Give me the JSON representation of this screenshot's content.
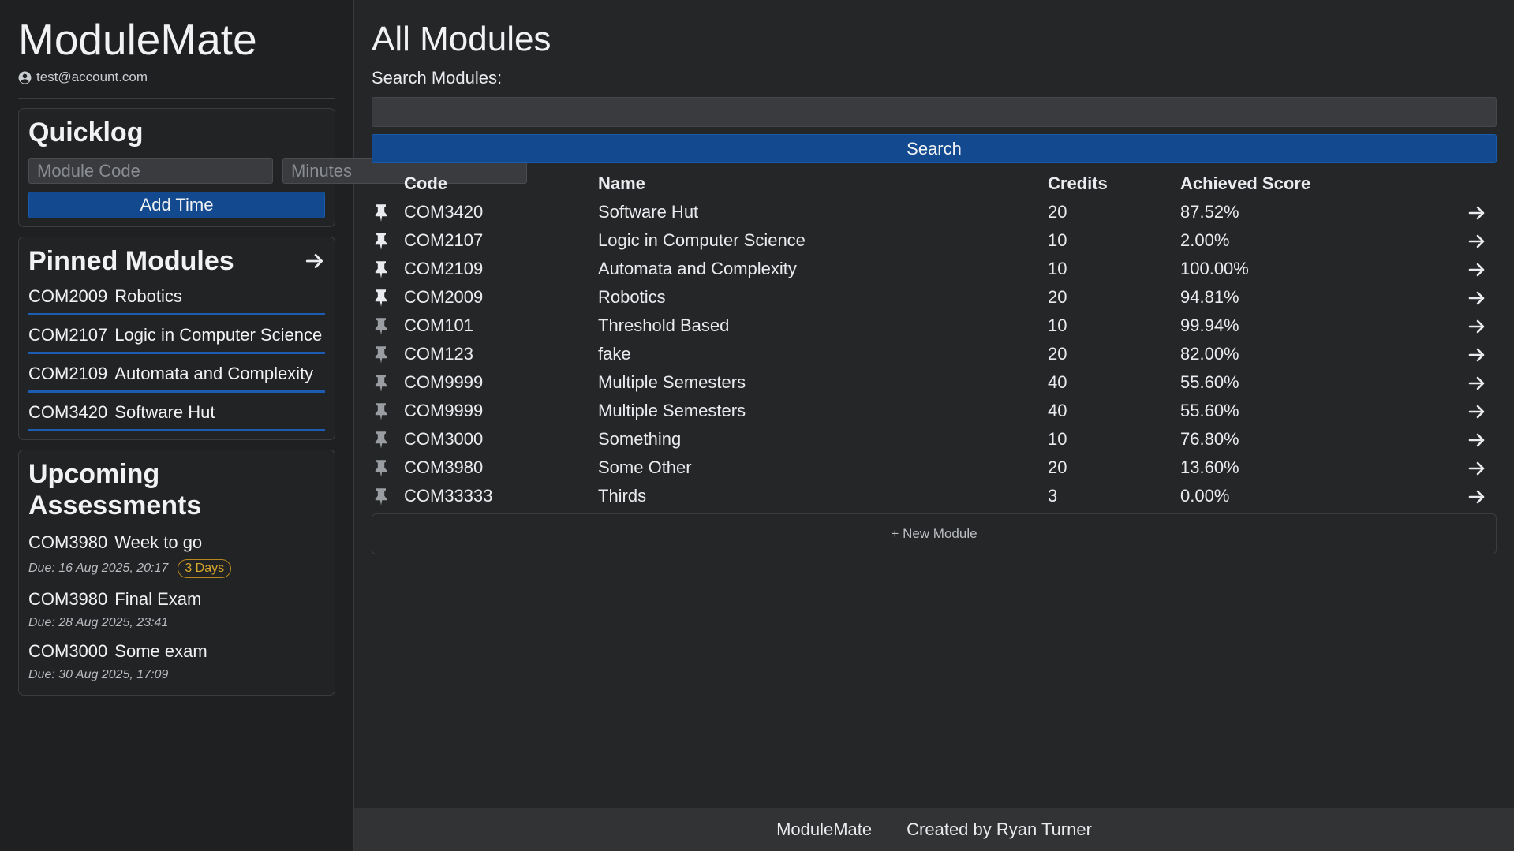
{
  "sidebar": {
    "brand": "ModuleMate",
    "account_email": "test@account.com",
    "quicklog": {
      "title": "Quicklog",
      "module_code_placeholder": "Module Code",
      "minutes_placeholder": "Minutes",
      "add_label": "Add Time"
    },
    "pinned": {
      "title": "Pinned Modules",
      "items": [
        {
          "code": "COM2009",
          "name": "Robotics"
        },
        {
          "code": "COM2107",
          "name": "Logic in Computer Science"
        },
        {
          "code": "COM2109",
          "name": "Automata and Complexity"
        },
        {
          "code": "COM3420",
          "name": "Software Hut"
        }
      ]
    },
    "upcoming": {
      "title": "Upcoming Assessments",
      "items": [
        {
          "code": "COM3980",
          "name": "Week to go",
          "due": "Due: 16 Aug 2025, 20:17",
          "badge": "3 Days"
        },
        {
          "code": "COM3980",
          "name": "Final Exam",
          "due": "Due: 28 Aug 2025, 23:41",
          "badge": ""
        },
        {
          "code": "COM3000",
          "name": "Some exam",
          "due": "Due: 30 Aug 2025, 17:09",
          "badge": ""
        }
      ]
    }
  },
  "main": {
    "title": "All Modules",
    "search_label": "Search Modules:",
    "search_value": "",
    "search_button": "Search",
    "columns": {
      "code": "Code",
      "name": "Name",
      "credits": "Credits",
      "score": "Achieved Score"
    },
    "rows": [
      {
        "code": "COM3420",
        "name": "Software Hut",
        "credits": "20",
        "score": "87.52%",
        "pinned": true
      },
      {
        "code": "COM2107",
        "name": "Logic in Computer Science",
        "credits": "10",
        "score": "2.00%",
        "pinned": true
      },
      {
        "code": "COM2109",
        "name": "Automata and Complexity",
        "credits": "10",
        "score": "100.00%",
        "pinned": true
      },
      {
        "code": "COM2009",
        "name": "Robotics",
        "credits": "20",
        "score": "94.81%",
        "pinned": true
      },
      {
        "code": "COM101",
        "name": "Threshold Based",
        "credits": "10",
        "score": "99.94%",
        "pinned": false
      },
      {
        "code": "COM123",
        "name": "fake",
        "credits": "20",
        "score": "82.00%",
        "pinned": false
      },
      {
        "code": "COM9999",
        "name": "Multiple Semesters",
        "credits": "40",
        "score": "55.60%",
        "pinned": false
      },
      {
        "code": "COM9999",
        "name": "Multiple Semesters",
        "credits": "40",
        "score": "55.60%",
        "pinned": false
      },
      {
        "code": "COM3000",
        "name": "Something",
        "credits": "10",
        "score": "76.80%",
        "pinned": false
      },
      {
        "code": "COM3980",
        "name": "Some Other",
        "credits": "20",
        "score": "13.60%",
        "pinned": false
      },
      {
        "code": "COM33333",
        "name": "Thirds",
        "credits": "3",
        "score": "0.00%",
        "pinned": false
      }
    ],
    "new_module_label": "+ New Module"
  },
  "footer": {
    "brand": "ModuleMate",
    "credit": "Created by Ryan Turner"
  },
  "colors": {
    "background": "#252628",
    "sidebar": "#1f2022",
    "primary": "#12498f",
    "accent_underline": "#1c5db3",
    "badge": "#d6a72c",
    "pin_active": "#e9ebee",
    "pin_inactive": "#9a9da2"
  }
}
